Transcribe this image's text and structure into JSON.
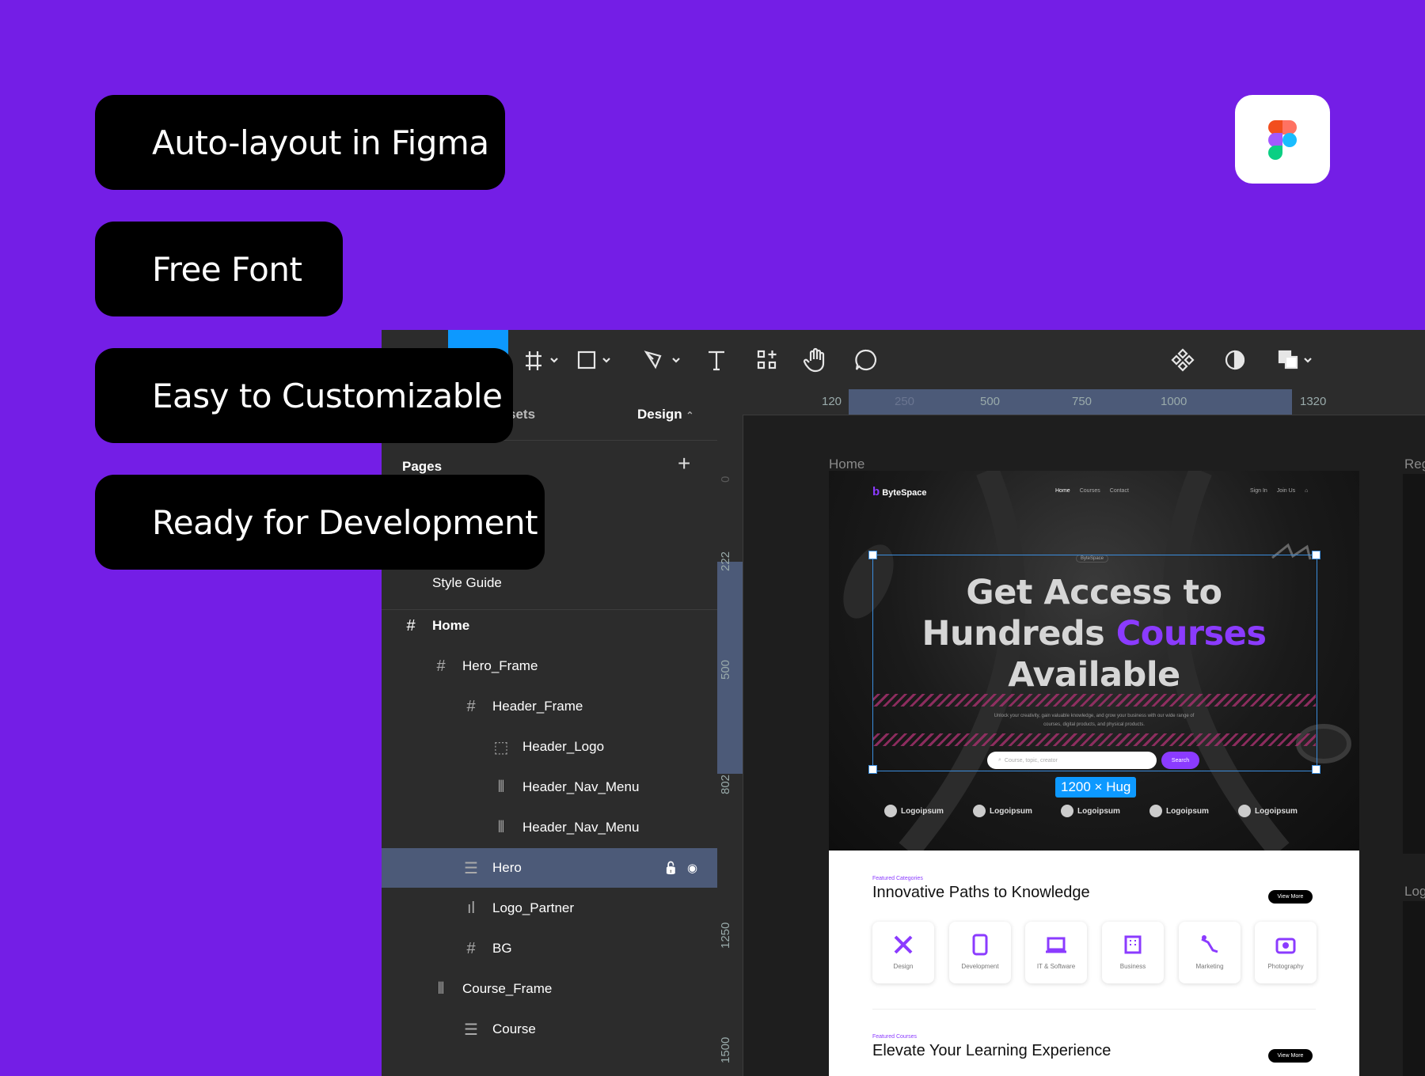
{
  "colors": {
    "background": "#741ee6",
    "accent": "#0d99ff",
    "purple_text": "#8b3bff",
    "selection": "#4c5a78"
  },
  "pills": [
    "Auto-layout in Figma",
    "Free Font",
    "Easy to Customizable",
    "Ready for Development"
  ],
  "figma_logo": "figma-logo",
  "toolbar": {
    "icons": [
      "frame-icon",
      "rectangle-icon",
      "pen-icon",
      "text-icon",
      "components-icon",
      "hand-icon",
      "comment-icon",
      "component-set-icon",
      "contrast-icon",
      "overlap-icon"
    ]
  },
  "sidebar": {
    "tab_assets": "sets",
    "tab_design": "Design",
    "pages_label": "Pages",
    "page_item": "Style Guide",
    "layers": [
      {
        "label": "Home",
        "icon": "#",
        "indent": 0,
        "bold": true
      },
      {
        "label": "Hero_Frame",
        "icon": "#",
        "indent": 1
      },
      {
        "label": "Header_Frame",
        "icon": "#",
        "indent": 2
      },
      {
        "label": "Header_Logo",
        "icon": "⬚",
        "indent": 3
      },
      {
        "label": "Header_Nav_Menu",
        "icon": "⦀",
        "indent": 3
      },
      {
        "label": "Header_Nav_Menu",
        "icon": "⦀",
        "indent": 3
      },
      {
        "label": "Hero",
        "icon": "☰",
        "indent": 2,
        "selected": true
      },
      {
        "label": "Logo_Partner",
        "icon": "ıl",
        "indent": 2
      },
      {
        "label": "BG",
        "icon": "#",
        "indent": 2
      },
      {
        "label": "Course_Frame",
        "icon": "⦀",
        "indent": 1
      },
      {
        "label": "Course",
        "icon": "☰",
        "indent": 2
      }
    ]
  },
  "ruler_top": [
    "120",
    "250",
    "500",
    "750",
    "1000",
    "1320"
  ],
  "ruler_left": [
    "0",
    "222",
    "500",
    "802",
    "1250",
    "1500"
  ],
  "canvas": {
    "frame_label": "Home",
    "next_frame_label": "Reg",
    "next_frame_label2": "Log",
    "size_badge": "1200 × Hug",
    "site": {
      "logo": "ByteSpace",
      "nav": [
        "Home",
        "Courses",
        "Contact"
      ],
      "auth": [
        "Sign In",
        "Join Us"
      ],
      "tag": "ByteSpace",
      "headline_1": "Get Access to",
      "headline_2a": "Hundreds ",
      "headline_2b": "Courses",
      "headline_3": "Available",
      "sub": "Unlock your creativity, gain valuable knowledge, and grow your business with our wide range of courses, digital products, and physical products.",
      "search_placeholder": "Course, topic, creator",
      "search_btn": "Search",
      "partners": [
        "Logoipsum",
        "Logoipsum",
        "Logoipsum",
        "Logoipsum",
        "Logoipsum"
      ],
      "section1_eyebrow": "Featured Categories",
      "section1_title": "Innovative Paths to Knowledge",
      "view_more": "View More",
      "categories": [
        "Design",
        "Development",
        "IT & Software",
        "Business",
        "Marketing",
        "Photography"
      ],
      "section2_eyebrow": "Featured Courses",
      "section2_title": "Elevate Your Learning Experience"
    }
  }
}
